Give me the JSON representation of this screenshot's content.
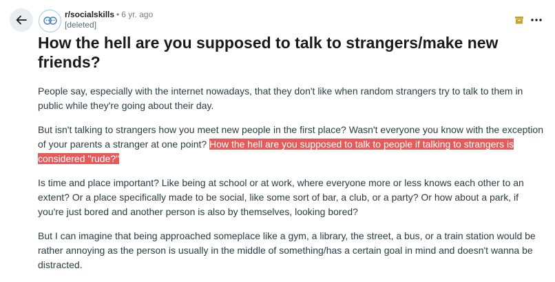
{
  "header": {
    "back_icon": "arrow-left-icon",
    "subreddit_icon": "subreddit-avatar-icon",
    "subreddit": "r/socialskills",
    "separator": "•",
    "age": "6 yr. ago",
    "author": "[deleted]",
    "archive_icon": "archive-box-icon",
    "more_icon": "ellipsis-horizontal-icon"
  },
  "post": {
    "title": "How the hell are you supposed to talk to strangers/make new friends?",
    "p1": "People say, especially with the internet nowadays, that they don't like when random strangers try to talk to them in public while they're going about their day.",
    "p2_before": "But isn't talking to strangers how you meet new people in the first place? Wasn't everyone you know with the exception of your parents a stranger at one point? ",
    "p2_highlight": "How the hell are you supposed to talk to people if talking to strangers is considered \"rude?\"",
    "p3": "Is time and place important? Like being at school or at work, where everyone more or less knows each other to an extent? Or a place specifically made to be social, like some sort of bar, a club, or a party? Or how about a park, if you're just bored and another person is also by themselves, looking bored?",
    "p4": "But I can imagine that being approached someplace like a gym, a library, the street, a bus, or a train station would be rather annoying as the person is usually in the middle of something/has a certain goal in mind and doesn't wanna be distracted."
  },
  "colors": {
    "highlight": "#e45b5b",
    "archive_icon": "#c9a227",
    "back_button_bg": "#eaedef"
  }
}
